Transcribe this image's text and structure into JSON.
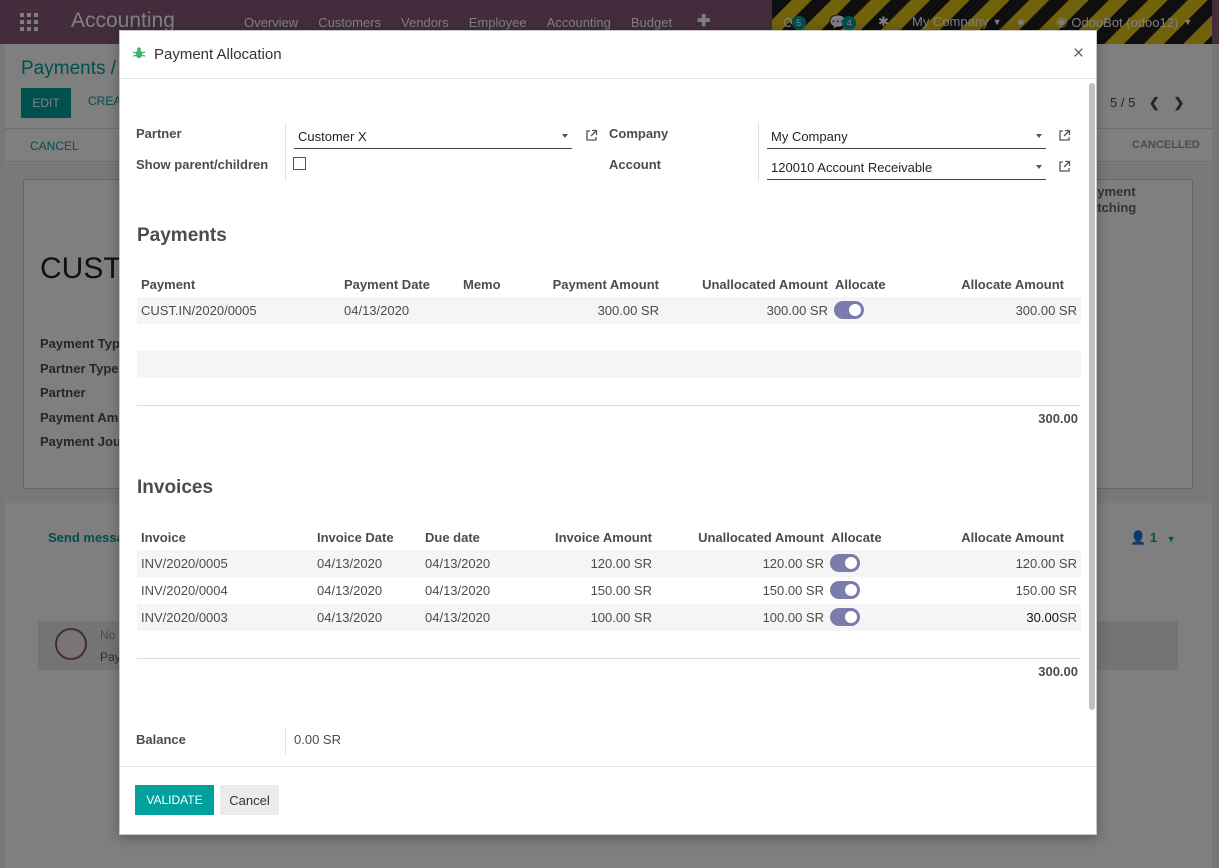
{
  "app": {
    "brand": "Accounting",
    "menu": [
      "Overview",
      "Customers",
      "Vendors",
      "Employee",
      "Accounting",
      "Budget"
    ],
    "plus": "✚",
    "activity_count": "5",
    "messages_count": "4",
    "company": "My Company",
    "user": "OdooBot (odoo12)"
  },
  "background": {
    "breadcrumb": "Payments /",
    "edit_label": "EDIT",
    "create_label": "CREA",
    "pager": "5 / 5",
    "cancel_label": "CANCEL",
    "status_cancelled": "CANCELLED",
    "record_title": "CUST.",
    "field_labels": [
      "Payment Typ",
      "Partner Type",
      "Partner",
      "Payment Amo",
      "Payment Jou"
    ],
    "matching_label_1": "ayment",
    "matching_label_2": "atching",
    "send_message": "Send messa",
    "followers": "1",
    "note_title": "No",
    "note_body": "Pay"
  },
  "modal": {
    "title": "Payment Allocation",
    "close": "×",
    "partner_label": "Partner",
    "partner_value": "Customer X",
    "show_parent_label": "Show parent/children",
    "company_label": "Company",
    "company_value": "My Company",
    "account_label": "Account",
    "account_value": "120010 Account Receivable",
    "payments": {
      "title": "Payments",
      "headers": [
        "Payment",
        "Payment Date",
        "Memo",
        "Payment Amount",
        "Unallocated Amount",
        "Allocate",
        "Allocate Amount"
      ],
      "rows": [
        {
          "payment": "CUST.IN/2020/0005",
          "date": "04/13/2020",
          "memo": "",
          "amount": "300.00 SR",
          "unallocated": "300.00 SR",
          "allocate": true,
          "allocate_amount": "300.00 SR"
        }
      ],
      "total": "300.00"
    },
    "invoices": {
      "title": "Invoices",
      "headers": [
        "Invoice",
        "Invoice Date",
        "Due date",
        "Invoice Amount",
        "Unallocated Amount",
        "Allocate",
        "Allocate Amount"
      ],
      "rows": [
        {
          "invoice": "INV/2020/0005",
          "date": "04/13/2020",
          "due": "04/13/2020",
          "amount": "120.00 SR",
          "unallocated": "120.00 SR",
          "allocate": true,
          "allocate_amount": "120.00 SR"
        },
        {
          "invoice": "INV/2020/0004",
          "date": "04/13/2020",
          "due": "04/13/2020",
          "amount": "150.00 SR",
          "unallocated": "150.00 SR",
          "allocate": true,
          "allocate_amount": "150.00 SR"
        },
        {
          "invoice": "INV/2020/0003",
          "date": "04/13/2020",
          "due": "04/13/2020",
          "amount": "100.00 SR",
          "unallocated": "100.00 SR",
          "allocate": true,
          "allocate_amount_value": "30.00",
          "allocate_amount_currency": "SR"
        }
      ],
      "total": "300.00"
    },
    "balance_label": "Balance",
    "balance_value": "0.00 SR",
    "validate_label": "VALIDATE",
    "cancel_label": "Cancel"
  },
  "colors": {
    "brand_purple": "#875a7b",
    "primary_teal": "#00a09d",
    "toggle_on": "#7c7bad"
  }
}
